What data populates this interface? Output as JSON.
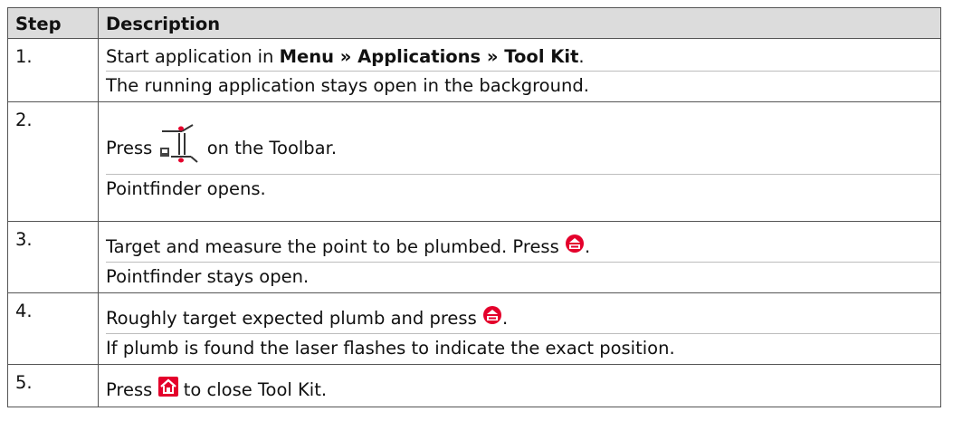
{
  "headers": {
    "step": "Step",
    "description": "Description"
  },
  "rows": [
    {
      "step": "1.",
      "line1": {
        "pre": "Start application in ",
        "bold": "Menu » Applications » Tool Kit",
        "post": "."
      },
      "line2": "The running application stays open in the background."
    },
    {
      "step": "2.",
      "line1": {
        "pre": "Press ",
        "icon": "pointfinder-toolbar-icon",
        "post": " on the Toolbar."
      },
      "line2": "Pointfinder opens."
    },
    {
      "step": "3.",
      "line1": {
        "pre": "Target and measure the point to be plumbed. Press ",
        "icon": "dist-key-icon",
        "post": "."
      },
      "line2": "Pointfinder stays open."
    },
    {
      "step": "4.",
      "line1": {
        "pre": "Roughly target expected plumb and press ",
        "icon": "dist-key-icon",
        "post": "."
      },
      "line2": "If plumb is found the laser flashes to indicate the exact position."
    },
    {
      "step": "5.",
      "line1": {
        "pre": "Press ",
        "icon": "home-key-icon",
        "post": " to close Tool Kit."
      }
    }
  ],
  "colors": {
    "header_bg": "#dcdcdc",
    "icon_red": "#e4002b",
    "border": "#555555"
  }
}
